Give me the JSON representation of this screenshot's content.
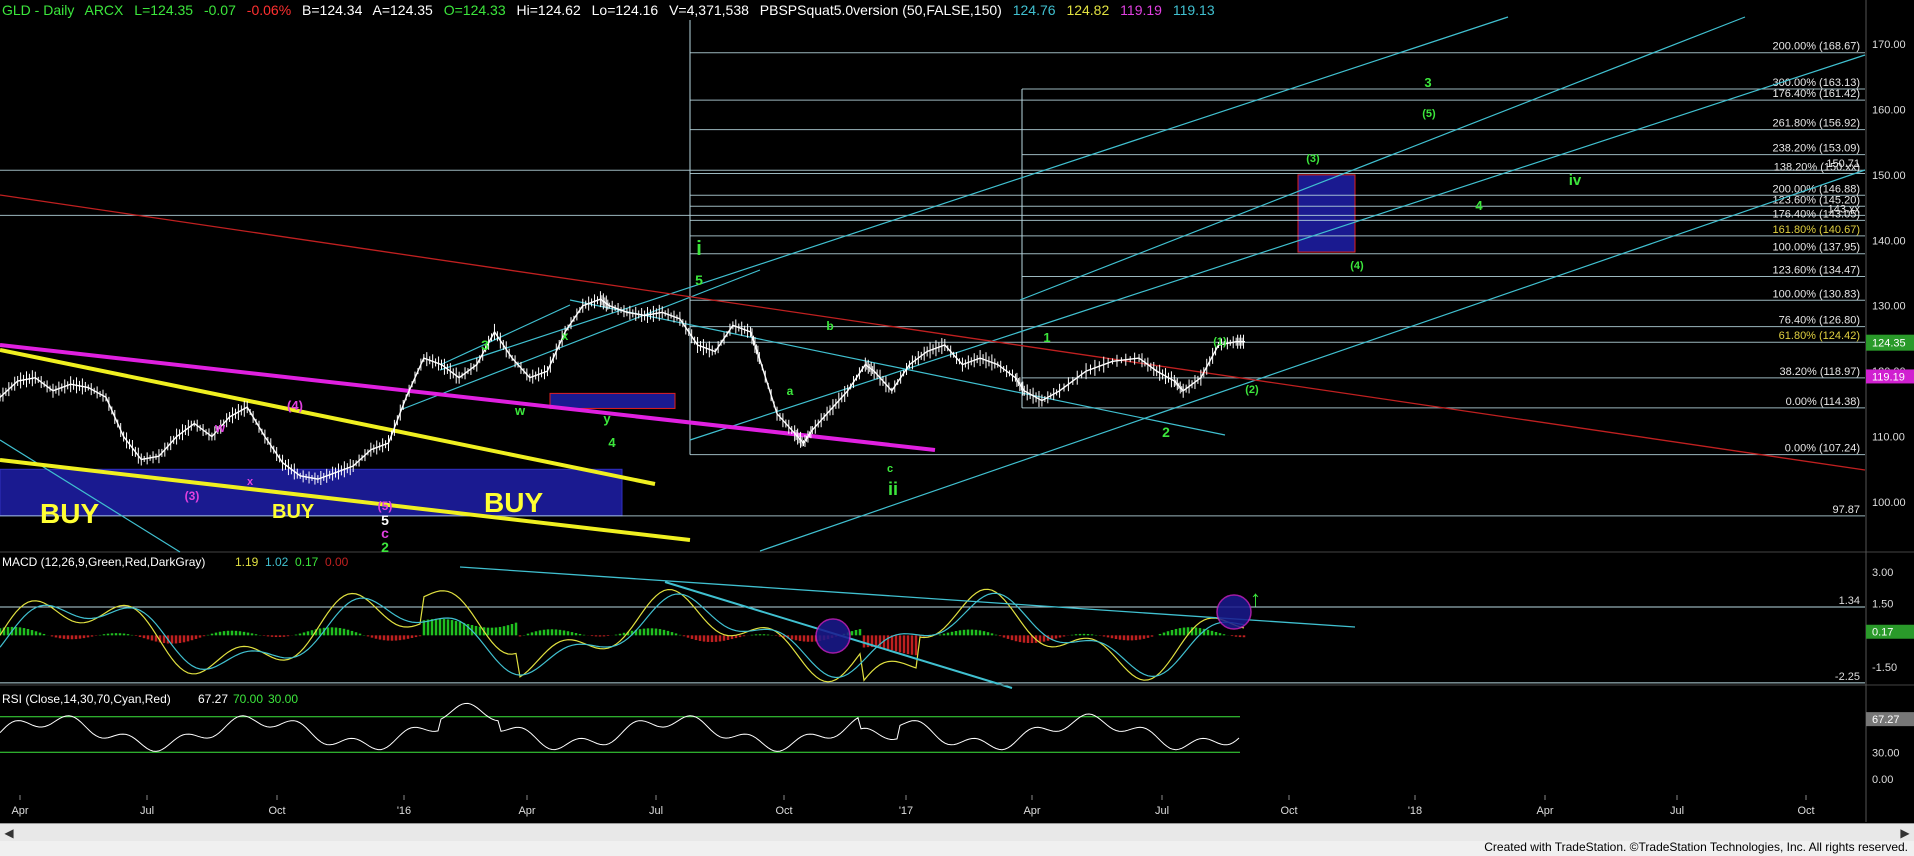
{
  "header": {
    "symbol": "GLD - Daily",
    "exchange": "ARCX",
    "last": "L=124.35",
    "change": "-0.07",
    "pct": "-0.06%",
    "bid": "B=124.34",
    "ask": "A=124.35",
    "open": "O=124.33",
    "high": "Hi=124.62",
    "low": "Lo=124.16",
    "volume": "V=4,371,538",
    "study": "PBSPSquat5.0version (50,FALSE,150)",
    "v1": "124.76",
    "v2": "124.82",
    "v3": "119.19",
    "v4": "119.13"
  },
  "colors": {
    "background": "#000000",
    "price_bars": "#ffffff",
    "channel": "#40c0d0",
    "wave_green": "#3ce63c",
    "wave_magenta": "#e040e0",
    "buy_box": "#1a1a90",
    "buy_text": "#ffff33",
    "yellow_line": "#f0f020",
    "magenta_line": "#e020e0",
    "red_line": "#c02020",
    "macd_hist_pos": "#20c020",
    "macd_hist_neg": "#c02020",
    "rsi_line": "#ffffff"
  },
  "chart_data": [
    {
      "type": "line",
      "panel": "price",
      "series": [
        {
          "values": [
            [
              0,
              116
            ],
            [
              20,
              118.5
            ],
            [
              40,
              119
            ],
            [
              60,
              117
            ],
            [
              80,
              118
            ],
            [
              100,
              117.5
            ],
            [
              120,
              116
            ],
            [
              140,
              110
            ],
            [
              160,
              106.5
            ],
            [
              180,
              107
            ],
            [
              200,
              110
            ],
            [
              220,
              112
            ],
            [
              240,
              110
            ],
            [
              260,
              113
            ],
            [
              280,
              114.5
            ],
            [
              300,
              110
            ],
            [
              320,
              106
            ],
            [
              340,
              104
            ],
            [
              360,
              103.5
            ],
            [
              380,
              104.5
            ],
            [
              400,
              105.5
            ],
            [
              420,
              108
            ],
            [
              440,
              109
            ],
            [
              460,
              116
            ],
            [
              480,
              122
            ],
            [
              500,
              121
            ],
            [
              520,
              119
            ],
            [
              540,
              121
            ],
            [
              560,
              126
            ],
            [
              580,
              122
            ],
            [
              600,
              119
            ],
            [
              620,
              120
            ],
            [
              640,
              126
            ],
            [
              660,
              130
            ],
            [
              680,
              131
            ],
            [
              690,
              130
            ],
            [
              710,
              129
            ],
            [
              730,
              128.5
            ],
            [
              750,
              129
            ],
            [
              770,
              128
            ],
            [
              790,
              124
            ],
            [
              810,
              123
            ],
            [
              830,
              127
            ],
            [
              850,
              126
            ],
            [
              860,
              122
            ],
            [
              880,
              113.5
            ],
            [
              900,
              110.5
            ],
            [
              910,
              109
            ],
            [
              920,
              111
            ],
            [
              940,
              114
            ],
            [
              960,
              117
            ],
            [
              980,
              121
            ],
            [
              990,
              120
            ],
            [
              1010,
              117
            ],
            [
              1030,
              121
            ],
            [
              1050,
              123
            ],
            [
              1070,
              124
            ],
            [
              1090,
              121
            ],
            [
              1110,
              122
            ],
            [
              1130,
              121
            ],
            [
              1150,
              119
            ],
            [
              1160,
              117
            ],
            [
              1180,
              115.5
            ],
            [
              1200,
              117
            ],
            [
              1230,
              120
            ],
            [
              1260,
              121.5
            ],
            [
              1290,
              122
            ],
            [
              1310,
              120
            ],
            [
              1330,
              118.5
            ],
            [
              1340,
              117
            ],
            [
              1360,
              119
            ],
            [
              1380,
              124
            ],
            [
              1400,
              124.5
            ],
            [
              1410,
              124.5
            ]
          ]
        }
      ],
      "x_ticks": [
        "Apr",
        "Jul",
        "Oct",
        "'16",
        "Apr",
        "Jul",
        "Oct",
        "'17",
        "Apr",
        "Jul",
        "Oct",
        "'18",
        "Apr",
        "Jul",
        "Oct"
      ],
      "y_ticks": [
        "170.00",
        "160.00",
        "150.00",
        "140.00",
        "130.00",
        "120.00",
        "110.00",
        "100.00"
      ],
      "ylim": [
        93.5,
        176.5
      ],
      "last_price_label": "124.35",
      "secondary_label": "119.19",
      "fib_levels": [
        {
          "label": "200.00% (168.67)",
          "price": 168.67
        },
        {
          "label": "300.00% (163.13)",
          "price": 163.13
        },
        {
          "label": "176.40% (161.42)",
          "price": 161.42
        },
        {
          "label": "261.80% (156.92)",
          "price": 156.92
        },
        {
          "label": "238.20% (153.09)",
          "price": 153.09
        },
        {
          "label": "150.71",
          "price": 150.71
        },
        {
          "label": "138.20% (150.xx)",
          "price": 150.2
        },
        {
          "label": "200.00% (146.88)",
          "price": 146.88
        },
        {
          "label": "123.60% (145.20)",
          "price": 145.2
        },
        {
          "label": "143.xx",
          "price": 143.8
        },
        {
          "label": "176.40% (143.05)",
          "price": 143.05
        },
        {
          "label": "161.80% (140.67)",
          "price": 140.67
        },
        {
          "label": "100.00% (137.95)",
          "price": 137.95
        },
        {
          "label": "123.60% (134.47)",
          "price": 134.47
        },
        {
          "label": "100.00% (130.83)",
          "price": 130.83
        },
        {
          "label": "76.40% (126.80)",
          "price": 126.8
        },
        {
          "label": "61.80% (124.42)",
          "price": 124.42
        },
        {
          "label": "38.20% (118.97)",
          "price": 118.97
        },
        {
          "label": "0.00% (114.38)",
          "price": 114.38
        },
        {
          "label": "0.00% (107.24)",
          "price": 107.24
        },
        {
          "label": "97.87",
          "price": 97.87
        }
      ],
      "wave_labels": [
        {
          "text": "3",
          "color": "green"
        },
        {
          "text": "x",
          "color": "green"
        },
        {
          "text": "w",
          "color": "green"
        },
        {
          "text": "y",
          "color": "green"
        },
        {
          "text": "4",
          "color": "green"
        },
        {
          "text": "5",
          "color": "green"
        },
        {
          "text": "i",
          "color": "green"
        },
        {
          "text": "b",
          "color": "green"
        },
        {
          "text": "a",
          "color": "green"
        },
        {
          "text": "c",
          "color": "green"
        },
        {
          "text": "ii",
          "color": "green"
        },
        {
          "text": "1",
          "color": "green"
        },
        {
          "text": "2",
          "color": "green"
        },
        {
          "text": "(1)",
          "color": "green"
        },
        {
          "text": "(2)",
          "color": "green"
        },
        {
          "text": "(3)",
          "color": "green"
        },
        {
          "text": "(4)",
          "color": "green"
        },
        {
          "text": "(5)",
          "color": "green"
        },
        {
          "text": "3",
          "color": "green"
        },
        {
          "text": "4",
          "color": "green"
        },
        {
          "text": "iv",
          "color": "green"
        },
        {
          "text": "(4)",
          "color": "magenta"
        },
        {
          "text": "w",
          "color": "magenta"
        },
        {
          "text": "x",
          "color": "magenta"
        },
        {
          "text": "(3)",
          "color": "magenta"
        },
        {
          "text": "(5)",
          "color": "magenta"
        },
        {
          "text": "c",
          "color": "magenta"
        },
        {
          "text": "5",
          "color": "white"
        },
        {
          "text": "2",
          "color": "green"
        }
      ],
      "buy_labels": [
        "BUY",
        "BUY",
        "BUY"
      ]
    },
    {
      "type": "line",
      "panel": "macd",
      "title": "MACD (12,26,9,Green,Red,DarkGray)",
      "values_display": [
        "1.19",
        "1.02",
        "0.17",
        "0.00"
      ],
      "y_ticks": [
        "3.00",
        "1.50",
        "0.17",
        "-1.50"
      ],
      "level_labels": [
        "1.34",
        "-2.25"
      ],
      "ylim": [
        -3.6,
        3.8
      ]
    },
    {
      "type": "line",
      "panel": "rsi",
      "title": "RSI (Close,14,30,70,Cyan,Red)",
      "values_display": [
        "67.27",
        "70.00",
        "30.00"
      ],
      "y_ticks": [
        "67.27",
        "30.00",
        "0.00"
      ],
      "ylim": [
        -5,
        105
      ]
    }
  ],
  "footer": {
    "text": "Created with TradeStation. ©TradeStation Technologies, Inc. All rights reserved."
  }
}
